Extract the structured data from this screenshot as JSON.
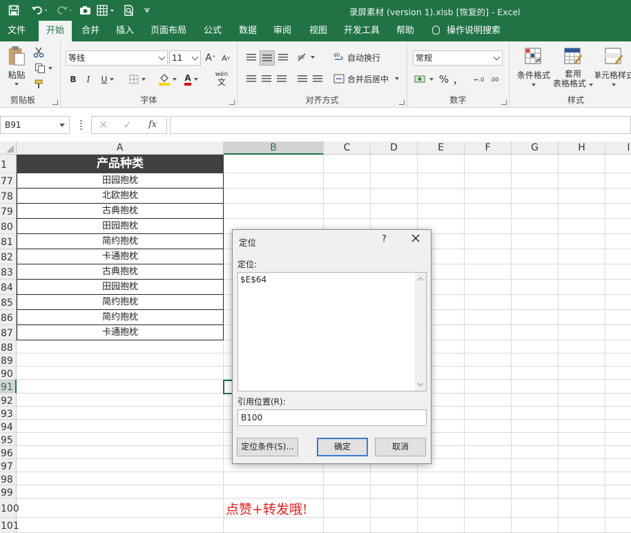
{
  "titlebar": {
    "title": "录屏素材 (version 1).xlsb [恢复的]  -  Excel",
    "icons": [
      "save-icon",
      "undo-icon",
      "redo-icon",
      "camera-icon",
      "form-icon",
      "print-preview-icon",
      "customize-icon"
    ]
  },
  "tabs": [
    "文件",
    "开始",
    "合并",
    "插入",
    "页面布局",
    "公式",
    "数据",
    "审阅",
    "视图",
    "开发工具",
    "帮助"
  ],
  "tellme": "操作说明搜索",
  "ribbon": {
    "clipboard": {
      "paste": "粘贴",
      "label": "剪贴板"
    },
    "font": {
      "name": "等线",
      "size": "11",
      "grow": "A",
      "shrink": "A",
      "bold": "B",
      "italic": "I",
      "underline": "U",
      "phonetic": "wén",
      "phonetic_char": "文",
      "label": "字体"
    },
    "alignment": {
      "wrap_text": "自动换行",
      "merge_center": "合并后居中",
      "label": "对齐方式"
    },
    "number": {
      "format": "常规",
      "percent": "%",
      "comma": "，",
      "label": "数字"
    },
    "styles": {
      "conditional": "条件格式",
      "table_line1": "套用",
      "table_line2": "表格格式",
      "cell_styles": "单元格样式",
      "label": "样式"
    }
  },
  "formula_bar": {
    "name_box": "B91",
    "fx": "fx",
    "formula": ""
  },
  "sheet": {
    "columns": [
      "A",
      "B",
      "C",
      "D",
      "E",
      "F",
      "G",
      "H",
      "I"
    ],
    "header_cell": "产品种类",
    "rows": [
      {
        "num": "1",
        "a": ""
      },
      {
        "num": "77",
        "a": "田园抱枕"
      },
      {
        "num": "78",
        "a": "北欧抱枕"
      },
      {
        "num": "79",
        "a": "古典抱枕"
      },
      {
        "num": "80",
        "a": "田园抱枕"
      },
      {
        "num": "81",
        "a": "简约抱枕"
      },
      {
        "num": "82",
        "a": "卡通抱枕"
      },
      {
        "num": "83",
        "a": "古典抱枕"
      },
      {
        "num": "84",
        "a": "田园抱枕"
      },
      {
        "num": "85",
        "a": "简约抱枕"
      },
      {
        "num": "86",
        "a": "简约抱枕"
      },
      {
        "num": "87",
        "a": "卡通抱枕"
      },
      {
        "num": "88",
        "a": ""
      },
      {
        "num": "89",
        "a": ""
      },
      {
        "num": "90",
        "a": ""
      },
      {
        "num": "91",
        "a": ""
      },
      {
        "num": "92",
        "a": ""
      },
      {
        "num": "93",
        "a": ""
      },
      {
        "num": "94",
        "a": ""
      },
      {
        "num": "95",
        "a": ""
      },
      {
        "num": "96",
        "a": ""
      },
      {
        "num": "97",
        "a": ""
      },
      {
        "num": "98",
        "a": ""
      },
      {
        "num": "99",
        "a": ""
      },
      {
        "num": "100",
        "a": ""
      },
      {
        "num": "101",
        "a": ""
      }
    ],
    "promo_text": "点赞+转发哦!"
  },
  "dialog": {
    "title": "定位",
    "help": "?",
    "goto_label": "定位:",
    "goto_items": [
      "$E$64"
    ],
    "reference_label": "引用位置(R):",
    "reference_value": "B100",
    "special_button": "定位条件(S)...",
    "ok_button": "确定",
    "cancel_button": "取消"
  }
}
